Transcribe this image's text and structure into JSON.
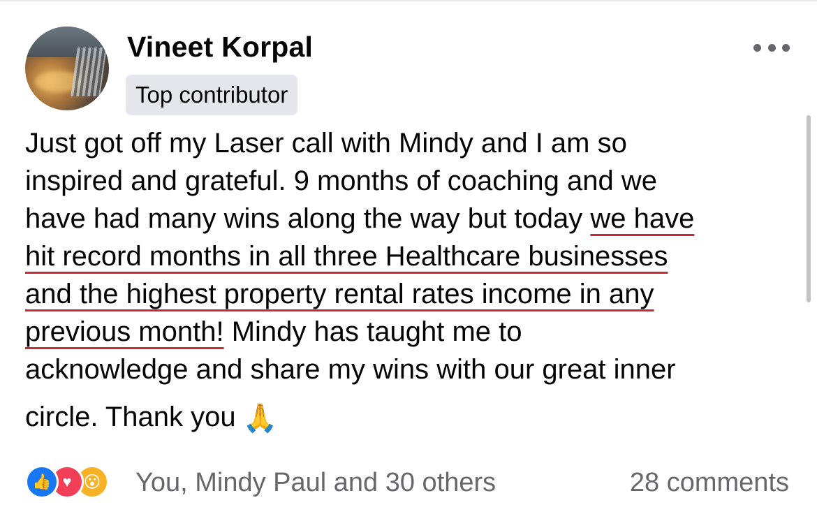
{
  "post": {
    "author": "Vineet Korpal",
    "badge": "Top contributor",
    "segments": {
      "s1": "Just got off my Laser call with Mindy and I am so\ninspired and grateful. 9 months of coaching and we\nhave had many wins along the way but today ",
      "s2": "we have\nhit record months in all three Healthcare businesses\nand the highest property rental rates income in any\nprevious month!",
      "s3": " Mindy has taught me to\nacknowledge and share my wins with our great inner",
      "s4": "circle. Thank you"
    },
    "emoji_icon": "folded-hands"
  },
  "footer": {
    "reactions": [
      "like",
      "love",
      "wow"
    ],
    "reaction_text": "You, Mindy Paul and 30 others",
    "comments": "28 comments"
  },
  "colors": {
    "underline": "#c42b35",
    "like": "#1877f2",
    "love": "#f33e58",
    "wow": "#f7b125",
    "muted": "#65676b"
  }
}
